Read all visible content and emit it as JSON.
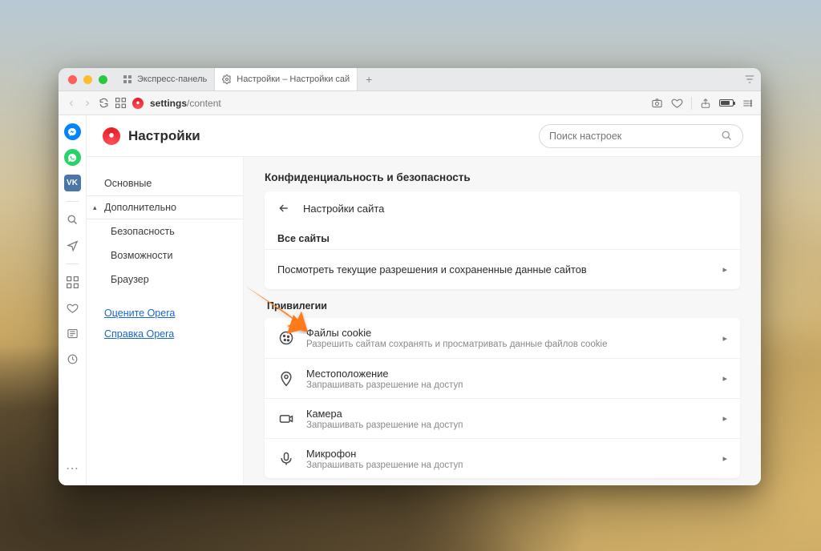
{
  "tabs": [
    {
      "label": "Экспресс-панель"
    },
    {
      "label": "Настройки – Настройки сай"
    }
  ],
  "url": {
    "prefix": "settings",
    "path": "/content"
  },
  "page": {
    "title": "Настройки"
  },
  "search": {
    "placeholder": "Поиск настроек"
  },
  "nav": {
    "basics": "Основные",
    "advanced": "Дополнительно",
    "security": "Безопасность",
    "features": "Возможности",
    "browser": "Браузер",
    "rate": "Оцените Opera",
    "help": "Справка Opera"
  },
  "section": {
    "privacy_title": "Конфиденциальность и безопасность",
    "site_settings": "Настройки сайта",
    "all_sites": "Все сайты",
    "view_permissions": "Посмотреть текущие разрешения и сохраненные данные сайтов",
    "privileges": "Привилегии"
  },
  "rows": {
    "cookies": {
      "title": "Файлы cookie",
      "sub": "Разрешить сайтам сохранять и просматривать данные файлов cookie"
    },
    "location": {
      "title": "Местоположение",
      "sub": "Запрашивать разрешение на доступ"
    },
    "camera": {
      "title": "Камера",
      "sub": "Запрашивать разрешение на доступ"
    },
    "mic": {
      "title": "Микрофон",
      "sub": "Запрашивать разрешение на доступ"
    }
  },
  "rail": {
    "vk": "VK"
  }
}
